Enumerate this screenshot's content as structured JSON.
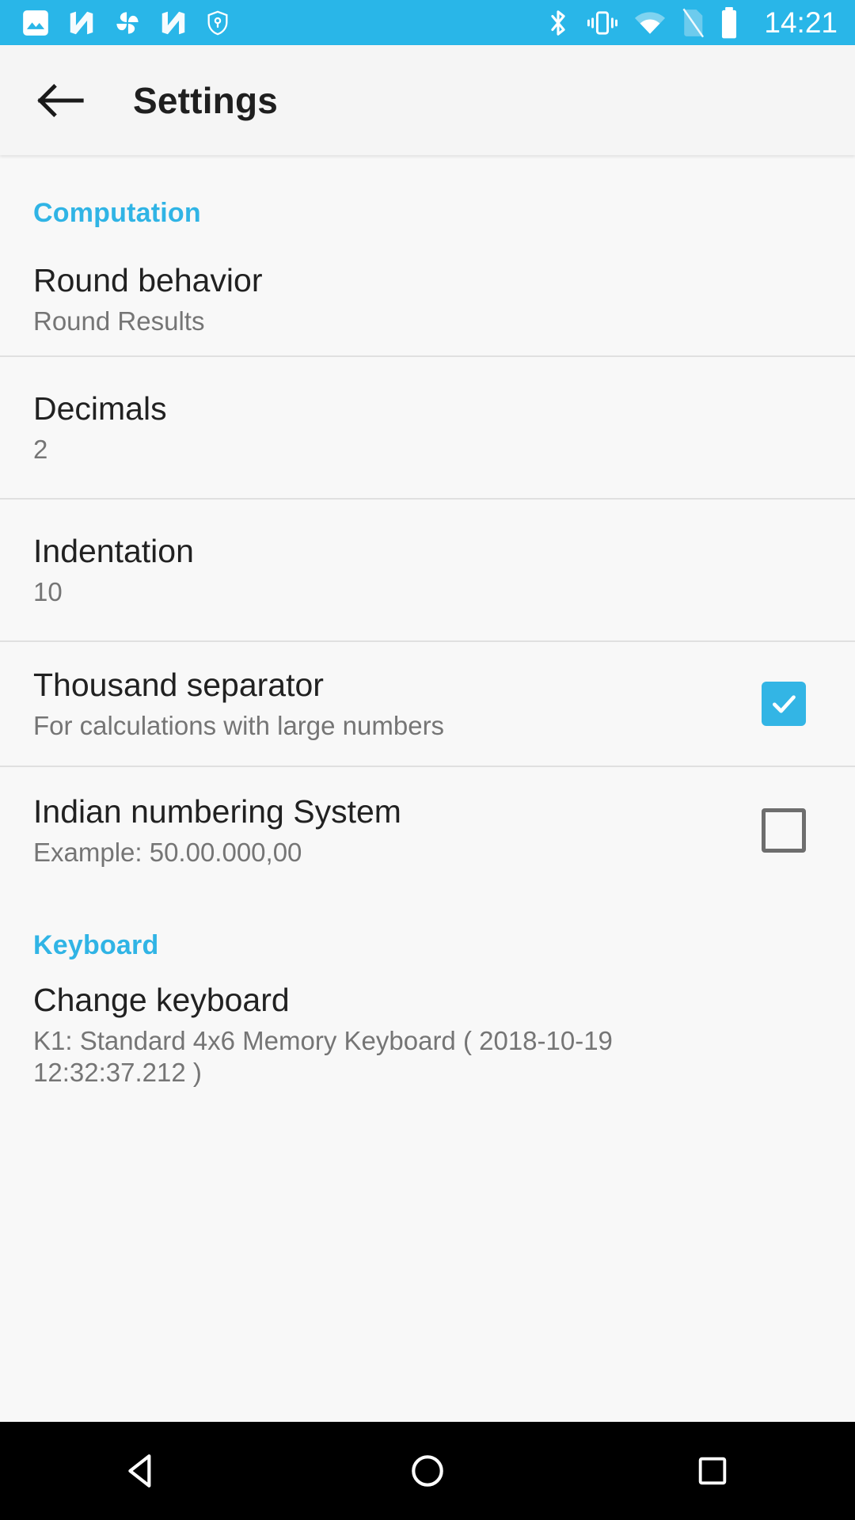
{
  "status_bar": {
    "background_color": "#29b6e8",
    "time": "14:21",
    "notification_icons": [
      "image-icon",
      "nougat-n-icon",
      "pinwheel-icon",
      "nougat-n-icon-2",
      "shield-key-icon"
    ],
    "system_icons": [
      "bluetooth-icon",
      "vibrate-icon",
      "wifi-icon",
      "no-sim-icon",
      "battery-full-icon"
    ]
  },
  "app_bar": {
    "back_label": "back-arrow",
    "title": "Settings"
  },
  "accent_color": "#33b5e5",
  "sections": [
    {
      "header": "Computation",
      "rows": [
        {
          "name": "round-behavior",
          "title": "Round behavior",
          "summary": "Round Results",
          "control": "none"
        },
        {
          "name": "decimals",
          "title": "Decimals",
          "summary": "2",
          "control": "none"
        },
        {
          "name": "indentation",
          "title": "Indentation",
          "summary": "10",
          "control": "none"
        },
        {
          "name": "thousand-separator",
          "title": "Thousand separator",
          "summary": "For calculations with large numbers",
          "control": "checkbox",
          "checked": true
        },
        {
          "name": "indian-numbering-system",
          "title": "Indian numbering System",
          "summary": "Example: 50.00.000,00",
          "control": "checkbox",
          "checked": false
        }
      ]
    },
    {
      "header": "Keyboard",
      "rows": [
        {
          "name": "change-keyboard",
          "title": "Change keyboard",
          "summary": "K1: Standard 4x6 Memory Keyboard ( 2018-10-19 12:32:37.212 )",
          "control": "none"
        }
      ]
    }
  ],
  "nav_bar": {
    "background_color": "#000000",
    "buttons": [
      "back-triangle-icon",
      "home-circle-icon",
      "recents-square-icon"
    ]
  }
}
